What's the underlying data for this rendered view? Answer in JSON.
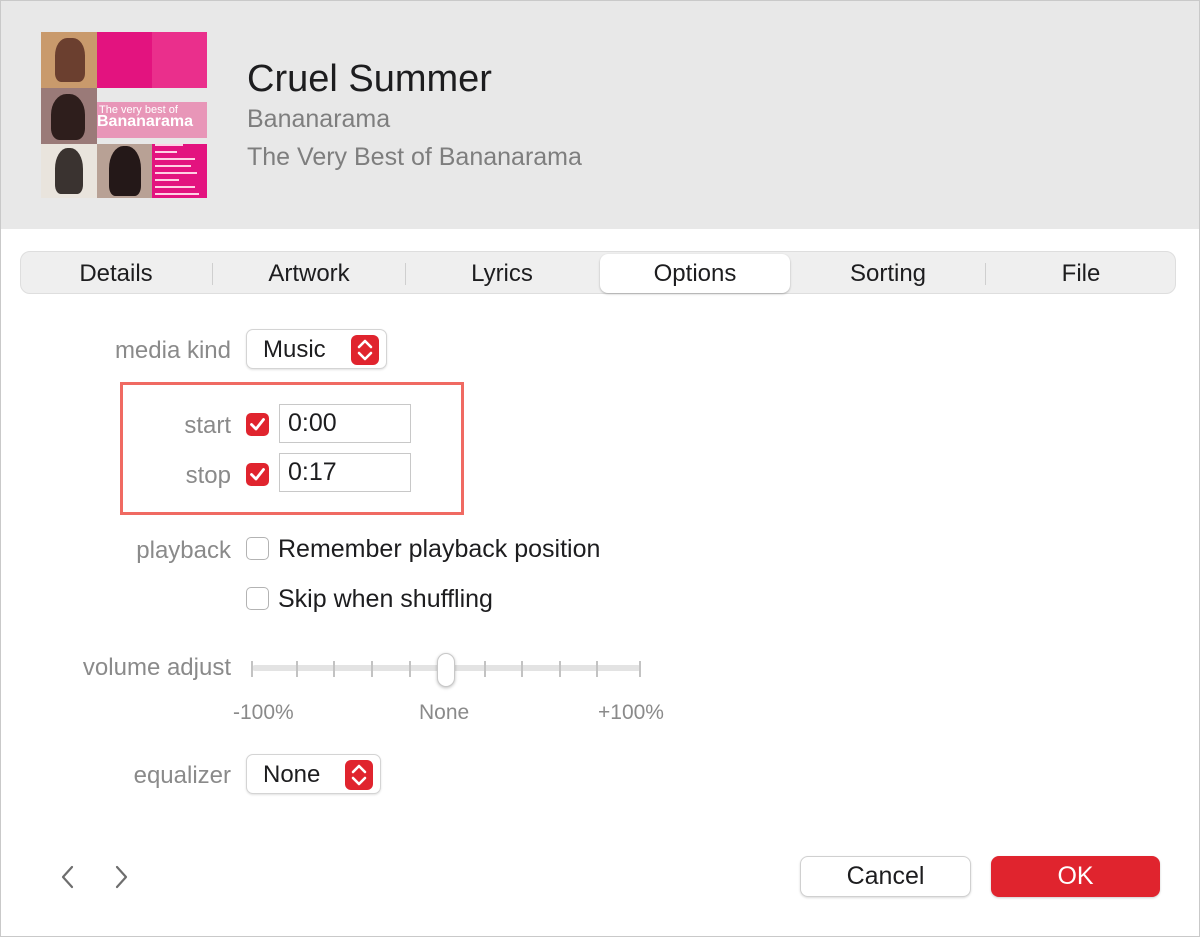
{
  "header": {
    "title": "Cruel Summer",
    "artist": "Bananarama",
    "album": "The Very Best of Bananarama",
    "artwork": {
      "line1": "The very best of",
      "line2": "Bananarama"
    }
  },
  "tabs": [
    {
      "label": "Details",
      "active": false
    },
    {
      "label": "Artwork",
      "active": false
    },
    {
      "label": "Lyrics",
      "active": false
    },
    {
      "label": "Options",
      "active": true
    },
    {
      "label": "Sorting",
      "active": false
    },
    {
      "label": "File",
      "active": false
    }
  ],
  "options": {
    "media_kind": {
      "label": "media kind",
      "value": "Music"
    },
    "start": {
      "label": "start",
      "checked": true,
      "value": "0:00"
    },
    "stop": {
      "label": "stop",
      "checked": true,
      "value": "0:17"
    },
    "playback": {
      "label": "playback",
      "remember": {
        "label": "Remember playback position",
        "checked": false
      },
      "skip": {
        "label": "Skip when shuffling",
        "checked": false
      }
    },
    "volume": {
      "label": "volume adjust",
      "min_label": "-100%",
      "mid_label": "None",
      "max_label": "+100%",
      "value_percent": 0
    },
    "equalizer": {
      "label": "equalizer",
      "value": "None"
    }
  },
  "footer": {
    "cancel_label": "Cancel",
    "ok_label": "OK"
  },
  "colors": {
    "accent": "#e0242e",
    "highlight": "#f06a62",
    "header_bg": "#e8e8e8"
  }
}
